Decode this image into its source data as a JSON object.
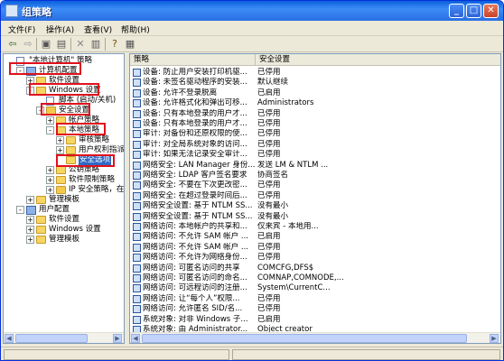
{
  "window": {
    "title": "组策略"
  },
  "menu": [
    "文件(F)",
    "操作(A)",
    "查看(V)",
    "帮助(H)"
  ],
  "toolbar_icons": [
    "back-icon",
    "forward-icon",
    "up-folder-icon",
    "properties-icon",
    "delete-icon",
    "export-icon",
    "help-icon",
    "view-icon"
  ],
  "tree": [
    {
      "label": "\"本地计算机\" 策略",
      "indent": 0,
      "expander": "",
      "icon": "doc"
    },
    {
      "label": "计算机配置",
      "indent": 1,
      "expander": "-",
      "icon": "pc"
    },
    {
      "label": "软件设置",
      "indent": 2,
      "expander": "+",
      "icon": "folder"
    },
    {
      "label": "Windows 设置",
      "indent": 2,
      "expander": "-",
      "icon": "folder"
    },
    {
      "label": "脚本 (启动/关机)",
      "indent": 3,
      "expander": "",
      "icon": "doc"
    },
    {
      "label": "安全设置",
      "indent": 3,
      "expander": "-",
      "icon": "lock"
    },
    {
      "label": "帐户策略",
      "indent": 4,
      "expander": "+",
      "icon": "folder"
    },
    {
      "label": "本地策略",
      "indent": 4,
      "expander": "-",
      "icon": "folder"
    },
    {
      "label": "审核策略",
      "indent": 5,
      "expander": "+",
      "icon": "folder"
    },
    {
      "label": "用户权利指派",
      "indent": 5,
      "expander": "+",
      "icon": "folder"
    },
    {
      "label": "安全选项",
      "indent": 5,
      "expander": "",
      "icon": "folder",
      "selected": true
    },
    {
      "label": "公钥策略",
      "indent": 4,
      "expander": "+",
      "icon": "folder"
    },
    {
      "label": "软件限制策略",
      "indent": 4,
      "expander": "+",
      "icon": "folder"
    },
    {
      "label": "IP 安全策略，在",
      "indent": 4,
      "expander": "+",
      "icon": "lock"
    },
    {
      "label": "管理模板",
      "indent": 2,
      "expander": "+",
      "icon": "folder"
    },
    {
      "label": "用户配置",
      "indent": 1,
      "expander": "-",
      "icon": "pc"
    },
    {
      "label": "软件设置",
      "indent": 2,
      "expander": "+",
      "icon": "folder"
    },
    {
      "label": "Windows 设置",
      "indent": 2,
      "expander": "+",
      "icon": "folder"
    },
    {
      "label": "管理模板",
      "indent": 2,
      "expander": "+",
      "icon": "folder"
    }
  ],
  "columns": [
    "策略",
    "安全设置"
  ],
  "policies": [
    {
      "policy": "设备: 防止用户安装打印机驱...",
      "setting": "已停用"
    },
    {
      "policy": "设备: 未签名驱动程序的安装...",
      "setting": "默认继续"
    },
    {
      "policy": "设备: 允许不登录脱离",
      "setting": "已启用"
    },
    {
      "policy": "设备: 允许格式化和弹出可移...",
      "setting": "Administrators"
    },
    {
      "policy": "设备: 只有本地登录的用户才...",
      "setting": "已停用"
    },
    {
      "policy": "设备: 只有本地登录的用户才...",
      "setting": "已停用"
    },
    {
      "policy": "审计: 对备份和还原权限的使...",
      "setting": "已停用"
    },
    {
      "policy": "审计: 对全局系统对象的访问...",
      "setting": "已停用"
    },
    {
      "policy": "审计: 如果无法记录安全审计...",
      "setting": "已停用"
    },
    {
      "policy": "网络安全: LAN Manager 身份...",
      "setting": "发送 LM & NTLM ..."
    },
    {
      "policy": "网络安全: LDAP 客户签名要求",
      "setting": "协商签名"
    },
    {
      "policy": "网络安全: 不要在下次更改密...",
      "setting": "已停用"
    },
    {
      "policy": "网络安全: 在超过登录时间后...",
      "setting": "已停用"
    },
    {
      "policy": "网络安全设置: 基于 NTLM SS...",
      "setting": "没有最小"
    },
    {
      "policy": "网络安全设置: 基于 NTLM SS...",
      "setting": "没有最小"
    },
    {
      "policy": "网络访问: 本地帐户的共享和...",
      "setting": "仅来宾 - 本地用..."
    },
    {
      "policy": "网络访问: 不允许 SAM 帐户 ...",
      "setting": "已启用"
    },
    {
      "policy": "网络访问: 不允许 SAM 帐户 ...",
      "setting": "已停用"
    },
    {
      "policy": "网络访问: 不允许为网络身份...",
      "setting": "已停用"
    },
    {
      "policy": "网络访问: 可匿名访问的共享",
      "setting": "COMCFG,DFS$"
    },
    {
      "policy": "网络访问: 可匿名访问的命名...",
      "setting": "COMNAP,COMNODE,..."
    },
    {
      "policy": "网络访问: 可远程访问的注册...",
      "setting": "System\\CurrentC..."
    },
    {
      "policy": "网络访问: 让“每个人”权限...",
      "setting": "已停用"
    },
    {
      "policy": "网络访问: 允许匿名 SID/名...",
      "setting": "已停用"
    },
    {
      "policy": "系统对象: 对非 Windows 子...",
      "setting": "已启用"
    },
    {
      "policy": "系统对象: 由 Administrator...",
      "setting": "Object creator"
    }
  ]
}
